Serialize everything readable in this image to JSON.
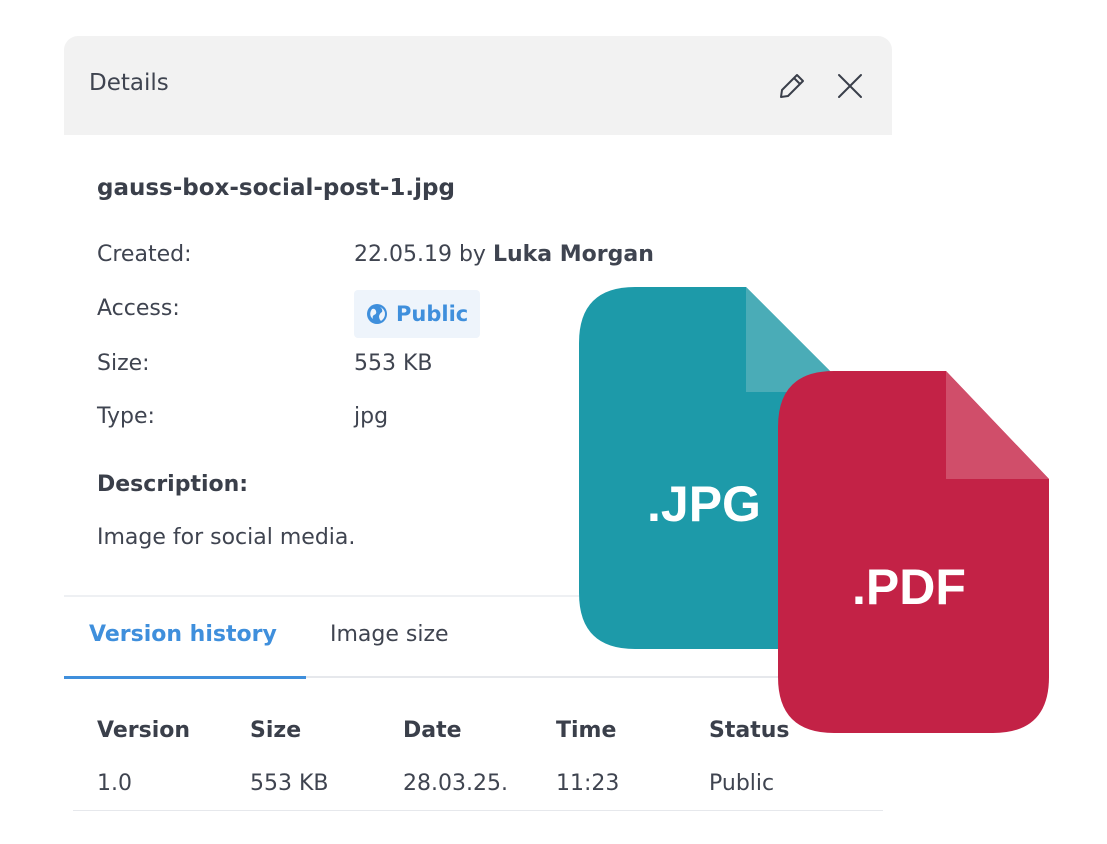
{
  "header": {
    "title": "Details"
  },
  "file": {
    "name": "gauss-box-social-post-1.jpg",
    "created_label": "Created:",
    "created_date": "22.05.19 by ",
    "created_by": "Luka Morgan",
    "access_label": "Access:",
    "access_value": "Public",
    "size_label": "Size:",
    "size_value": "553 KB",
    "type_label": "Type:",
    "type_value": "jpg",
    "description_heading": "Description:",
    "description_text": "Image for social media."
  },
  "tabs": [
    {
      "label": "Version history",
      "active": true
    },
    {
      "label": "Image size",
      "active": false
    }
  ],
  "table": {
    "headers": [
      "Version",
      "Size",
      "Date",
      "Time",
      "Status"
    ],
    "rows": [
      [
        "1.0",
        "553 KB",
        "28.03.25.",
        "11:23",
        "Public"
      ]
    ]
  },
  "file_badges": {
    "jpg": {
      "label": ".JPG",
      "color": "#1d9aa9",
      "fold_color": "#4aacb7"
    },
    "pdf": {
      "label": ".PDF",
      "color": "#c32246",
      "fold_color": "#d04e6a"
    }
  },
  "colors": {
    "accent": "#3f8fdc",
    "header_bg": "#f2f2f2"
  },
  "icons": {
    "edit": "pencil-icon",
    "close": "close-icon",
    "access": "globe-icon"
  }
}
